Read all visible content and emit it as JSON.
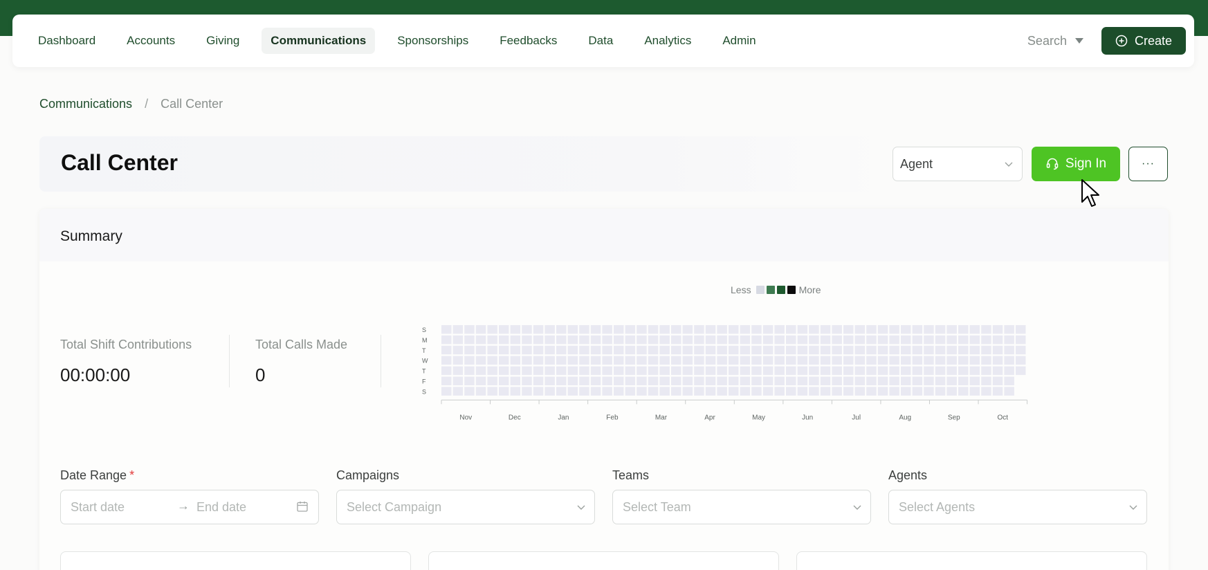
{
  "nav": {
    "items": [
      {
        "label": "Dashboard",
        "name": "nav-dashboard",
        "active": false
      },
      {
        "label": "Accounts",
        "name": "nav-accounts",
        "active": false
      },
      {
        "label": "Giving",
        "name": "nav-giving",
        "active": false
      },
      {
        "label": "Communications",
        "name": "nav-communications",
        "active": true
      },
      {
        "label": "Sponsorships",
        "name": "nav-sponsorships",
        "active": false
      },
      {
        "label": "Feedbacks",
        "name": "nav-feedbacks",
        "active": false
      },
      {
        "label": "Data",
        "name": "nav-data",
        "active": false
      },
      {
        "label": "Analytics",
        "name": "nav-analytics",
        "active": false
      },
      {
        "label": "Admin",
        "name": "nav-admin",
        "active": false
      }
    ],
    "search_label": "Search",
    "create_label": "Create"
  },
  "breadcrumb": {
    "root": "Communications",
    "separator": "/",
    "current": "Call Center"
  },
  "page": {
    "title": "Call Center",
    "role_select": "Agent",
    "sign_in_label": "Sign In",
    "more_label": "···"
  },
  "summary": {
    "title": "Summary",
    "stats": [
      {
        "label": "Total Shift Contributions",
        "value": "00:00:00"
      },
      {
        "label": "Total Calls Made",
        "value": "0"
      }
    ],
    "heatmap": {
      "legend_less": "Less",
      "legend_more": "More",
      "legend_colors": [
        "#d7dae3",
        "#3e7b51",
        "#1e5a2f",
        "#0c0c0c"
      ],
      "empty_color": "#e9e9f2",
      "day_labels": [
        "S",
        "M",
        "T",
        "W",
        "T",
        "F",
        "S"
      ],
      "months": [
        "Nov",
        "Dec",
        "Jan",
        "Feb",
        "Mar",
        "Apr",
        "May",
        "Jun",
        "Jul",
        "Aug",
        "Sep",
        "Oct"
      ],
      "weeks": 51,
      "last_week_filled_days": 5
    }
  },
  "filters": {
    "date_range": {
      "label": "Date Range",
      "required_mark": "*",
      "start_placeholder": "Start date",
      "end_placeholder": "End date"
    },
    "campaigns": {
      "label": "Campaigns",
      "placeholder": "Select Campaign"
    },
    "teams": {
      "label": "Teams",
      "placeholder": "Select Team"
    },
    "agents": {
      "label": "Agents",
      "placeholder": "Select Agents"
    }
  },
  "colors": {
    "brand_dark": "#1c4d2a",
    "accent_green": "#4ec424",
    "required": "#e23b3b"
  }
}
